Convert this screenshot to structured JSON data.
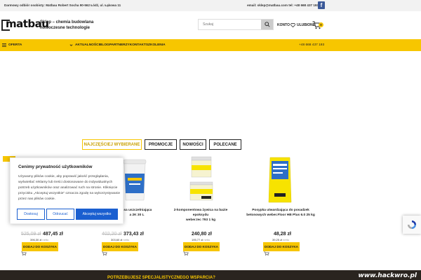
{
  "topbar": {
    "left_text": "Darmowy odbiór osobisty: Matbau Robert Socha 90-562 Łódź, ul. Łąkowa 11",
    "right_text": "email: sklep@matbau.com tel: +48 668 437 193"
  },
  "header": {
    "logo_text": "matbau",
    "tagline": "Sklep – chemia budowlana nowoczesne technologie",
    "search_placeholder": "Szukaj",
    "account_label": "KONTO",
    "wishlist_label": "ULUBIONE",
    "cart_count": "0"
  },
  "nav": {
    "menu_label": "OFERTA",
    "links": [
      "AKTUALNOŚCI",
      "BLOG",
      "PARTNERZY",
      "KONTAKT",
      "SZKOLENIA"
    ],
    "phone": "+48 668 437 193"
  },
  "tabs": [
    {
      "label": "NAJCZĘŚCIEJ WYBIERANE",
      "active": true
    },
    {
      "label": "PROMOCJE",
      "active": false
    },
    {
      "label": "NOWOŚCI",
      "active": false
    },
    {
      "label": "POLECANE",
      "active": false
    }
  ],
  "products": [
    {
      "name_line1": "asa uszczelniająca",
      "name_line2": "a 2K 30 L",
      "price_old": "402,20 zł",
      "price_new": "373,43 zł",
      "price_net": "303,60 zł",
      "net_suffix": "netto",
      "button": "DODAJ DO KOSZYKA"
    },
    {
      "name_line1": "2-komponentowa żywica na bazie epoksydu",
      "name_line2": "weber.tec 793 1 kg",
      "price_old": "",
      "price_new": "240,80 zł",
      "price_net": "195,77 zł",
      "net_suffix": "netto",
      "button": "DODAJ DO KOSZYKA"
    },
    {
      "name_line1": "Posypka utwardzająca do posadzek",
      "name_line2": "betonowych weber.Floor HB Plus 6.0 25 kg",
      "price_old": "",
      "price_new": "48,28 zł",
      "price_net": "39,25 zł",
      "net_suffix": "netto",
      "button": "DODAJ DO KOSZYKA"
    }
  ],
  "first_product": {
    "price_old": "525,09 zł",
    "price_new": "487,45 zł",
    "price_net": "396,30 zł",
    "net_suffix": "netto",
    "button": "DODAJ DO KOSZYKA"
  },
  "cookie": {
    "title": "Cenimy prywatność użytkowników",
    "text": "Używamy plików cookie, aby poprawić jakość przeglądania, wyświetlać reklamy lub treści dostosowane do indywidualnych potrzeb użytkowników oraz analizować ruch na stronie. Kliknięcie przycisku „Akceptuj wszystkie” oznacza zgodę na wykorzystywanie przez nas plików cookie.",
    "btn_settings": "Dostosuj",
    "btn_reject": "Odrzucać",
    "btn_accept": "Akceptuj wszystko"
  },
  "banner": {
    "text": "POTRZEBUJESZ SPECJALISTYCZNEGO WSPARCIA?"
  },
  "watermark": "www.hackwro.pl",
  "colors": {
    "accent": "#f7c600",
    "primary": "#1a5fd0",
    "dark": "#2a241f"
  }
}
